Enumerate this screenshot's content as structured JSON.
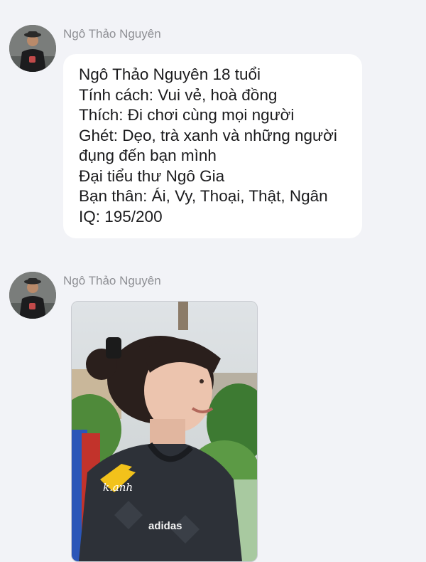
{
  "messages": [
    {
      "sender": "Ngô Thảo Nguyên",
      "avatar_icon": "user-avatar-icon",
      "lines": [
        "Ngô Thảo Nguyên 18 tuổi",
        "Tính cách: Vui vẻ, hoà đồng",
        "Thích: Đi chơi cùng mọi người",
        "Ghét: Dẹo, trà xanh và những người",
        "đụng đến bạn mình",
        "Đại tiểu thư Ngô Gia",
        "Bạn thân: Ái, Vy, Thoại, Thật, Ngân",
        "IQ: 195/200"
      ]
    },
    {
      "sender": "Ngô Thảo Nguyên",
      "avatar_icon": "user-avatar-icon",
      "photo": {
        "watermark": "k.anh",
        "shirt_brand": "adidas"
      }
    }
  ],
  "colors": {
    "background": "#f2f3f7",
    "bubble": "#ffffff",
    "sender_name": "#8e8f94",
    "text": "#1b1b1d"
  }
}
